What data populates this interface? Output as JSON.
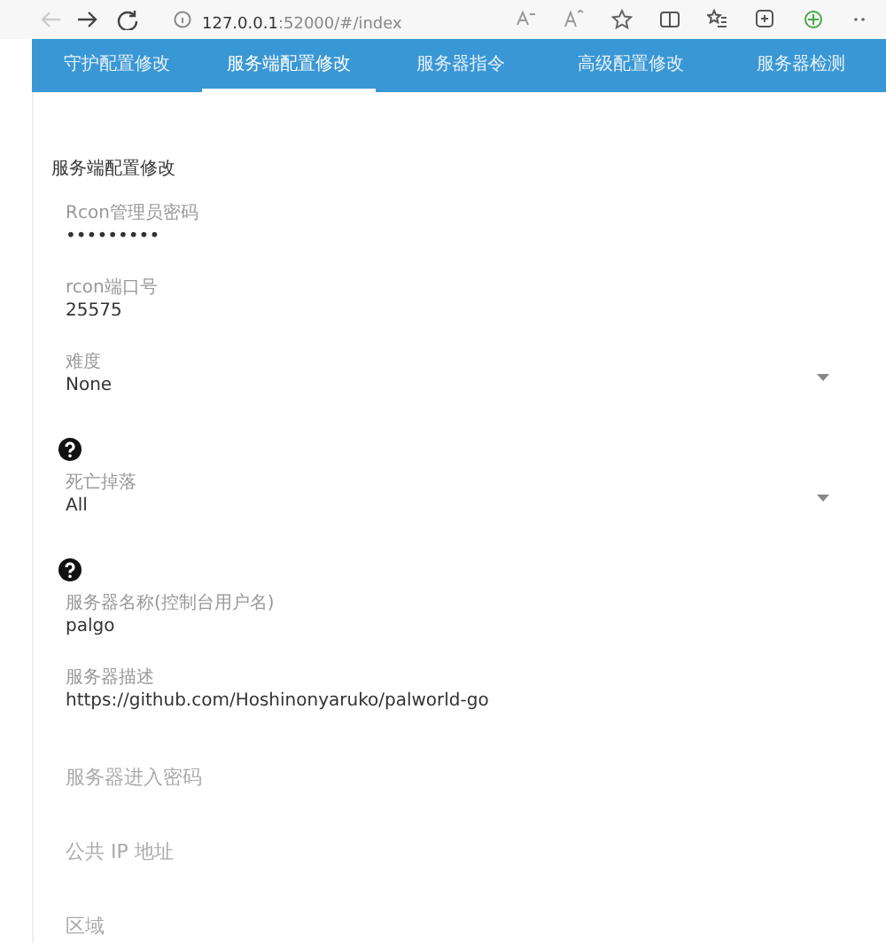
{
  "browser": {
    "nav_buttons": [
      {
        "kind": "back",
        "disabled": true
      },
      {
        "kind": "forward",
        "disabled": false
      },
      {
        "kind": "refresh",
        "disabled": false
      }
    ],
    "url_host": "127.0.0.1",
    "url_path": ":52000/#/index"
  },
  "tabs": [
    {
      "label": "守护配置修改",
      "selected": false
    },
    {
      "label": "服务端配置修改",
      "selected": true
    },
    {
      "label": "服务器指令",
      "selected": false
    },
    {
      "label": "高级配置修改",
      "selected": false
    },
    {
      "label": "服务器检测",
      "selected": false
    }
  ],
  "form": {
    "title": "服务端配置修改",
    "fields": [
      {
        "kind": "text",
        "label": "Rcon管理员密码",
        "value": "•••••••••"
      },
      {
        "kind": "text",
        "label": "rcon端口号",
        "value": "25575"
      },
      {
        "kind": "select",
        "label": "难度",
        "value": "None"
      },
      {
        "kind": "help"
      },
      {
        "kind": "select",
        "label": "死亡掉落",
        "value": "All"
      },
      {
        "kind": "help"
      },
      {
        "kind": "text",
        "label": "服务器名称(控制台用户名)",
        "value": "palgo"
      },
      {
        "kind": "text",
        "label": "服务器描述",
        "value": "https://github.com/Hoshinonyaruko/palworld-go"
      },
      {
        "kind": "empty",
        "placeholder": "服务器进入密码"
      },
      {
        "kind": "empty",
        "placeholder": "公共 IP 地址"
      },
      {
        "kind": "empty",
        "placeholder": "区域"
      }
    ]
  }
}
